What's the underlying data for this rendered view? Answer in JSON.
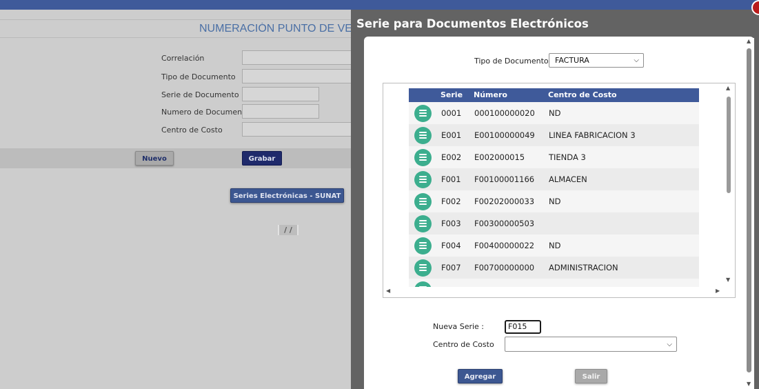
{
  "background": {
    "page_title": "NUMERACIÓN PUNTO DE VE",
    "form_labels": {
      "correlacion": "Correlación",
      "tipo_documento": "Tipo de Documento",
      "serie_documento": "Serie de Documento",
      "numero_documento": "Numero de Documento",
      "centro_costo": "Centro de Costo"
    },
    "buttons": {
      "nuevo": "Nuevo",
      "grabar": "Grabar",
      "series": "Series Electrónicas - SUNAT"
    },
    "pager_text": "/ /"
  },
  "modal": {
    "title": "Serie para Documentos Electrónicos",
    "tipo_label": "Tipo de Documento :",
    "tipo_value": "FACTURA",
    "grid": {
      "columns": [
        "Serie",
        "Número",
        "Centro de Costo"
      ],
      "rows": [
        {
          "serie": "0001",
          "numero": "000100000020",
          "centro": "ND"
        },
        {
          "serie": "E001",
          "numero": "E00100000049",
          "centro": "LINEA FABRICACION 3"
        },
        {
          "serie": "E002",
          "numero": "E002000015",
          "centro": "TIENDA 3"
        },
        {
          "serie": "F001",
          "numero": "F00100001166",
          "centro": "ALMACEN"
        },
        {
          "serie": "F002",
          "numero": "F00202000033",
          "centro": "ND"
        },
        {
          "serie": "F003",
          "numero": "F00300000503",
          "centro": ""
        },
        {
          "serie": "F004",
          "numero": "F00400000022",
          "centro": "ND"
        },
        {
          "serie": "F007",
          "numero": "F00700000000",
          "centro": "ADMINISTRACION"
        }
      ]
    },
    "nueva_serie_label": "Nueva Serie :",
    "nueva_serie_value": "F015",
    "centro_costo_label": "Centro de Costo",
    "centro_costo_value": "",
    "buttons": {
      "agregar": "Agregar",
      "salir": "Salir"
    }
  },
  "colors": {
    "topbar": "#3f5a9a",
    "grid_header": "#3f5a9a",
    "row_icon": "#3cae8e",
    "row_alt": "#ebebeb",
    "row_base": "#f5f5f5"
  }
}
